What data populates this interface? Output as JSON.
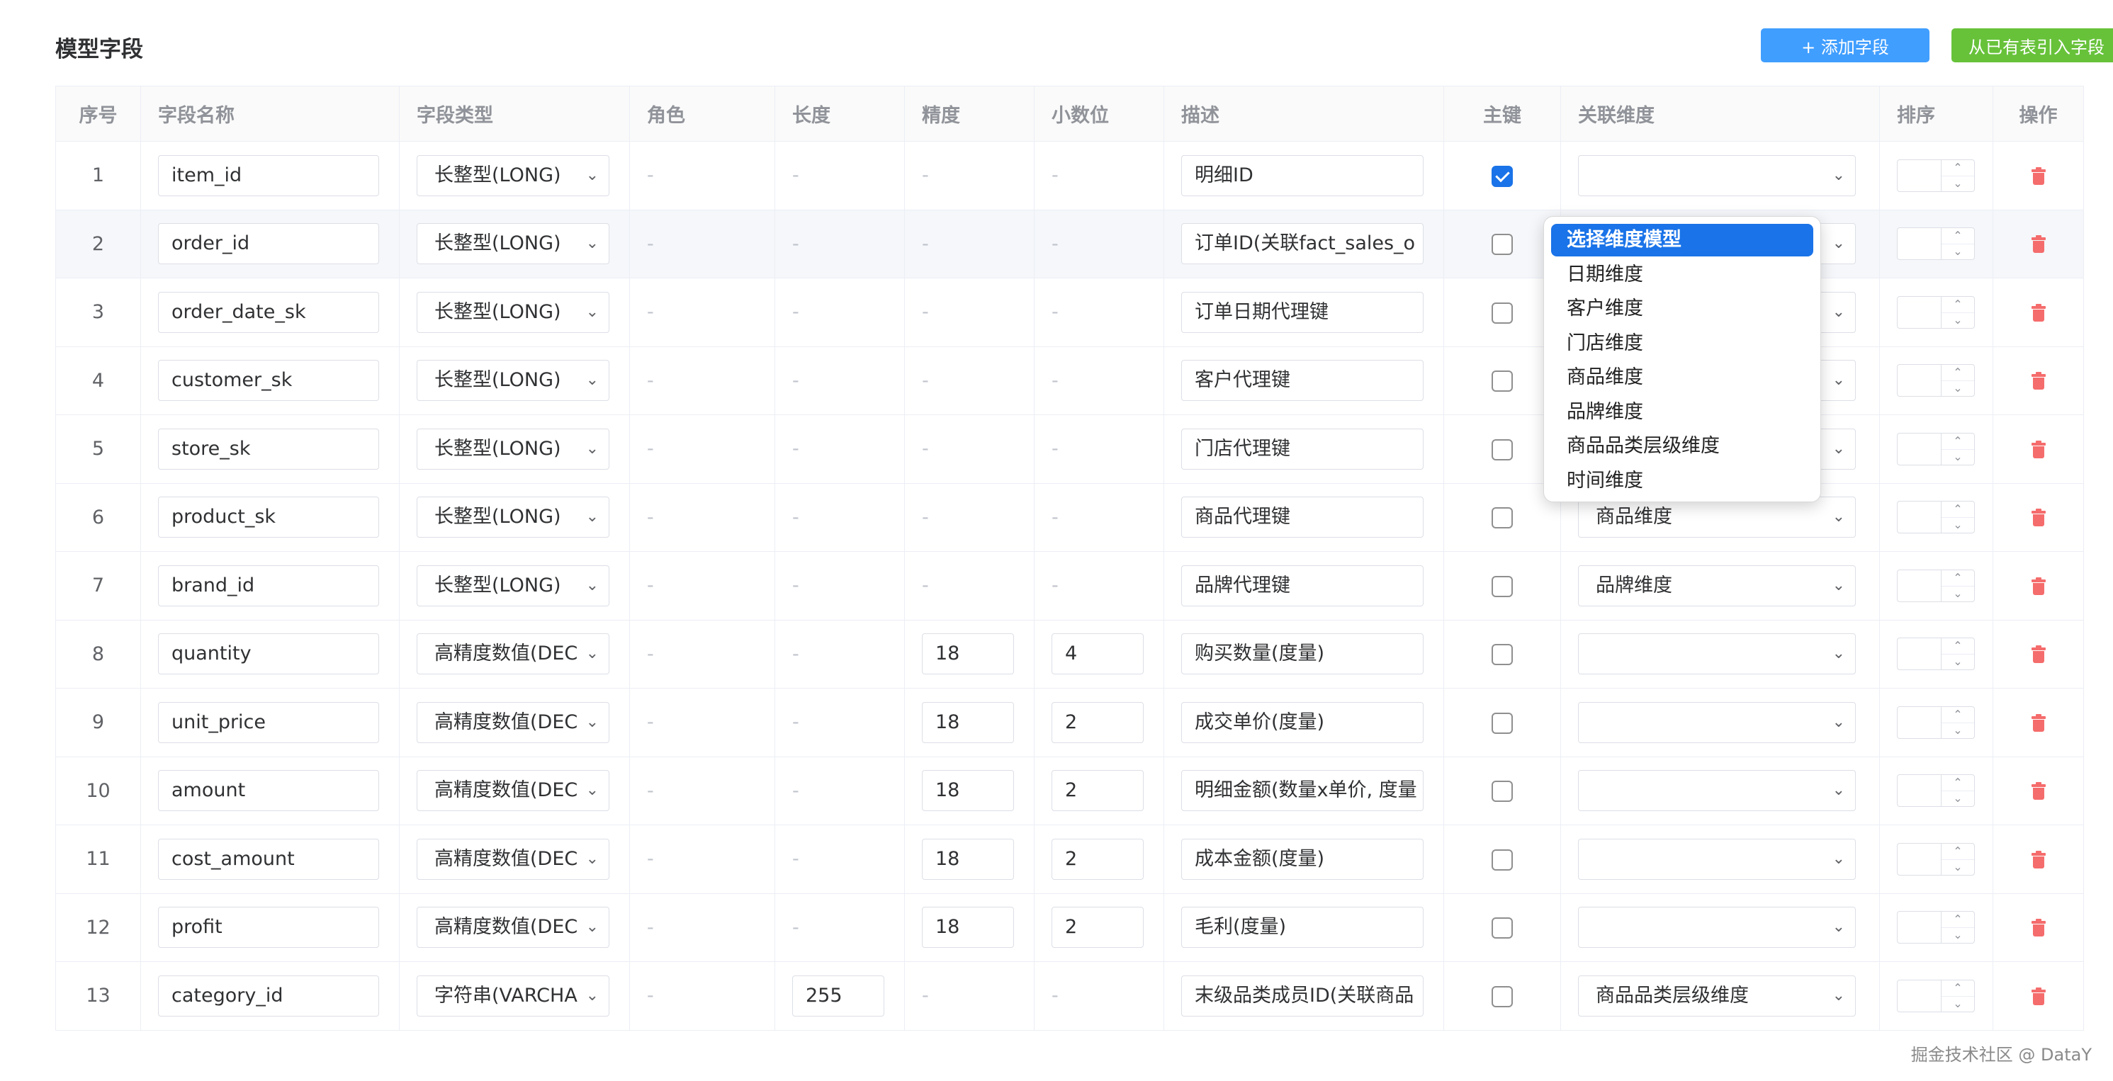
{
  "header": {
    "title": "模型字段",
    "add_button": "+ 添加字段",
    "import_button": "从已有表引入字段"
  },
  "columns": [
    "序号",
    "字段名称",
    "字段类型",
    "角色",
    "长度",
    "精度",
    "小数位",
    "描述",
    "主键",
    "关联维度",
    "排序",
    "操作"
  ],
  "rows": [
    {
      "index": "1",
      "name": "item_id",
      "type": "长整型(LONG)",
      "role": "-",
      "length": "-",
      "precision": "-",
      "scale": "-",
      "desc": "明细ID",
      "pk": true,
      "dimension": ""
    },
    {
      "index": "2",
      "name": "order_id",
      "type": "长整型(LONG)",
      "role": "-",
      "length": "-",
      "precision": "-",
      "scale": "-",
      "desc": "订单ID(关联fact_sales_o",
      "pk": false,
      "dimension": ""
    },
    {
      "index": "3",
      "name": "order_date_sk",
      "type": "长整型(LONG)",
      "role": "-",
      "length": "-",
      "precision": "-",
      "scale": "-",
      "desc": "订单日期代理键",
      "pk": false,
      "dimension": ""
    },
    {
      "index": "4",
      "name": "customer_sk",
      "type": "长整型(LONG)",
      "role": "-",
      "length": "-",
      "precision": "-",
      "scale": "-",
      "desc": "客户代理键",
      "pk": false,
      "dimension": ""
    },
    {
      "index": "5",
      "name": "store_sk",
      "type": "长整型(LONG)",
      "role": "-",
      "length": "-",
      "precision": "-",
      "scale": "-",
      "desc": "门店代理键",
      "pk": false,
      "dimension": ""
    },
    {
      "index": "6",
      "name": "product_sk",
      "type": "长整型(LONG)",
      "role": "-",
      "length": "-",
      "precision": "-",
      "scale": "-",
      "desc": "商品代理键",
      "pk": false,
      "dimension": "商品维度"
    },
    {
      "index": "7",
      "name": "brand_id",
      "type": "长整型(LONG)",
      "role": "-",
      "length": "-",
      "precision": "-",
      "scale": "-",
      "desc": "品牌代理键",
      "pk": false,
      "dimension": "品牌维度"
    },
    {
      "index": "8",
      "name": "quantity",
      "type": "高精度数值(DEC",
      "role": "-",
      "length": "-",
      "precision": "18",
      "scale": "4",
      "desc": "购买数量(度量)",
      "pk": false,
      "dimension": ""
    },
    {
      "index": "9",
      "name": "unit_price",
      "type": "高精度数值(DEC",
      "role": "-",
      "length": "-",
      "precision": "18",
      "scale": "2",
      "desc": "成交单价(度量)",
      "pk": false,
      "dimension": ""
    },
    {
      "index": "10",
      "name": "amount",
      "type": "高精度数值(DEC",
      "role": "-",
      "length": "-",
      "precision": "18",
      "scale": "2",
      "desc": "明细金额(数量x单价, 度量",
      "pk": false,
      "dimension": ""
    },
    {
      "index": "11",
      "name": "cost_amount",
      "type": "高精度数值(DEC",
      "role": "-",
      "length": "-",
      "precision": "18",
      "scale": "2",
      "desc": "成本金额(度量)",
      "pk": false,
      "dimension": ""
    },
    {
      "index": "12",
      "name": "profit",
      "type": "高精度数值(DEC",
      "role": "-",
      "length": "-",
      "precision": "18",
      "scale": "2",
      "desc": "毛利(度量)",
      "pk": false,
      "dimension": ""
    },
    {
      "index": "13",
      "name": "category_id",
      "type": "字符串(VARCHA",
      "role": "-",
      "length": "255",
      "precision": "-",
      "scale": "-",
      "desc": "末级品类成员ID(关联商品",
      "pk": false,
      "dimension": "商品品类层级维度"
    }
  ],
  "dropdown": {
    "options": [
      "选择维度模型",
      "日期维度",
      "客户维度",
      "门店维度",
      "商品维度",
      "品牌维度",
      "商品品类层级维度",
      "时间维度"
    ],
    "selected_index": 0
  },
  "watermark": "掘金技术社区 @ DataY",
  "colors": {
    "primary": "#409eff",
    "success": "#67c23a",
    "danger": "#f56c6c",
    "highlight": "#1a73e8"
  }
}
